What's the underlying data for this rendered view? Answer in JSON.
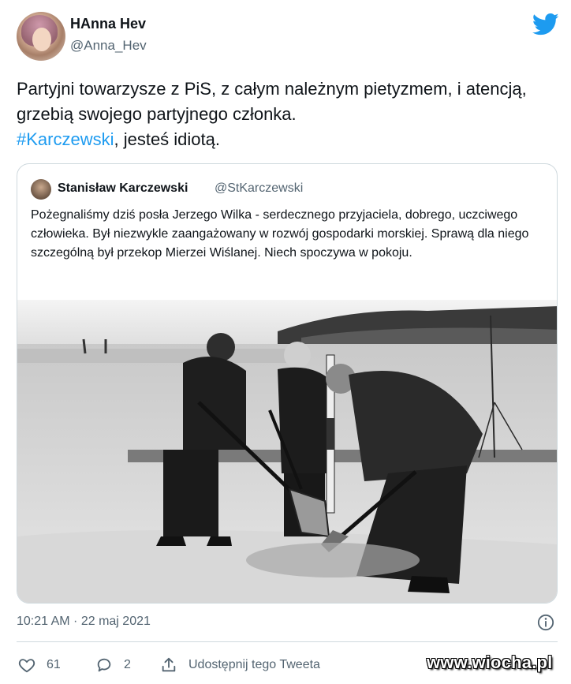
{
  "author": {
    "display_name": "HAnna Hev",
    "handle": "@Anna_Hev"
  },
  "tweet": {
    "text_part1": "Partyjni towarzysze z PiS, z całym należnym pietyzmem, i atencją, grzebią swojego partyjnego członka.",
    "hashtag": "#Karczewski",
    "text_part2": ", jesteś idiotą."
  },
  "quoted_tweet": {
    "display_name": "Stanisław Karczewski",
    "handle": "@StKarczewski",
    "text": "Pożegnaliśmy dziś posła Jerzego Wilka - serdecznego przyjaciela, dobrego, uczciwego człowieka. Był niezwykle zaangażowany w rozwój gospodarki morskiej. Sprawą dla niego szczególną był przekop Mierzei Wiślanej. Niech spoczywa w pokoju."
  },
  "meta": {
    "timestamp": "10:21 AM · 22 maj 2021"
  },
  "actions": {
    "likes": "61",
    "replies": "2",
    "share_label": "Udostępnij tego Tweeta"
  },
  "watermark": "www.wiocha.pl",
  "colors": {
    "accent": "#1d9bf0",
    "text": "#0f1419",
    "secondary": "#536471",
    "border": "#cfd9de"
  },
  "icons": [
    "twitter-bird-icon",
    "info-icon",
    "heart-icon",
    "reply-icon",
    "share-icon"
  ]
}
